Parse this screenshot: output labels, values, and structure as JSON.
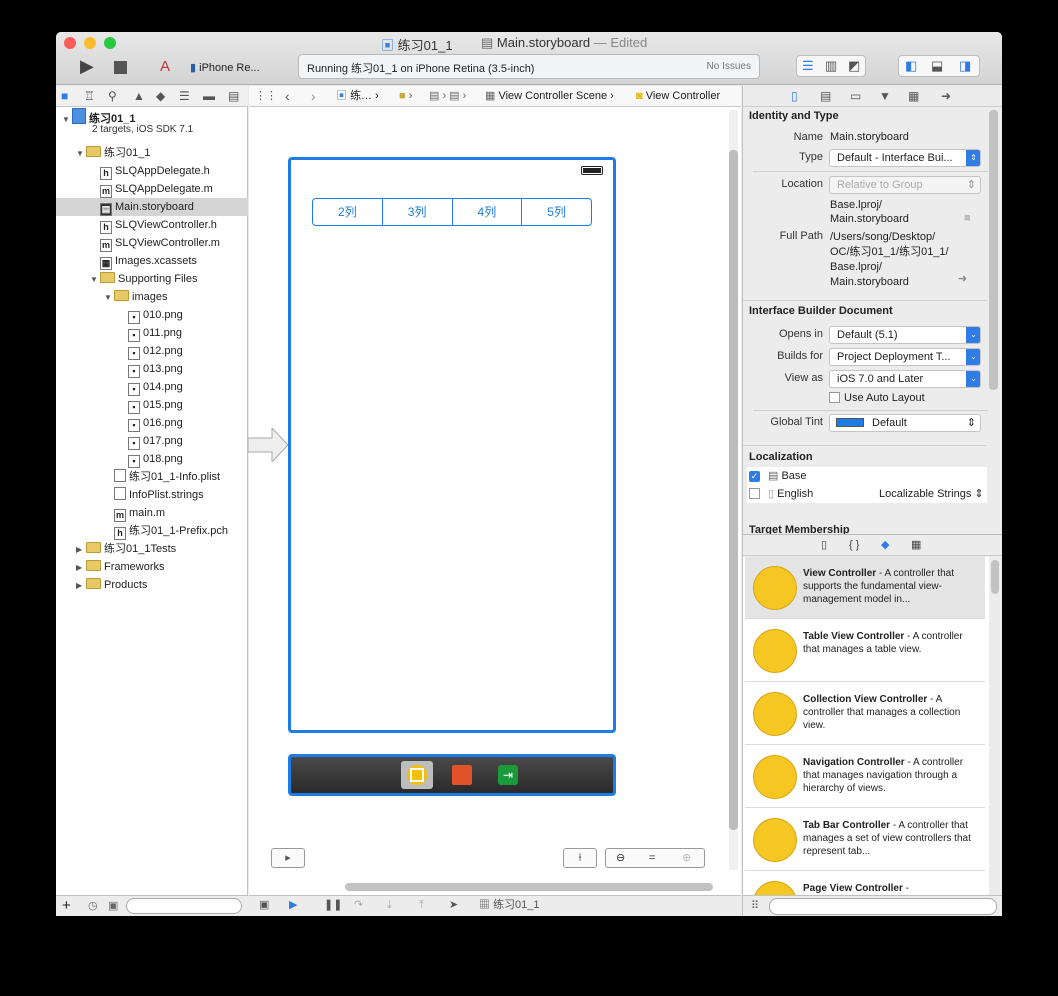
{
  "window": {
    "title_project": "练习01_1",
    "title_file": "Main.storyboard",
    "title_state": "— Edited"
  },
  "toolbar": {
    "scheme_target": "iPhone Re...",
    "status": "Running 练习01_1 on iPhone Retina (3.5-inch)",
    "issues": "No Issues"
  },
  "navigator": {
    "items": [
      {
        "label": "练习01_1",
        "sub": "2 targets, iOS SDK 7.1",
        "level": 0,
        "type": "project",
        "open": true
      },
      {
        "label": "练习01_1",
        "level": 1,
        "type": "folder",
        "open": true
      },
      {
        "label": "SLQAppDelegate.h",
        "level": 2,
        "type": "h"
      },
      {
        "label": "SLQAppDelegate.m",
        "level": 2,
        "type": "m"
      },
      {
        "label": "Main.storyboard",
        "level": 2,
        "type": "sb",
        "selected": true
      },
      {
        "label": "SLQViewController.h",
        "level": 2,
        "type": "h"
      },
      {
        "label": "SLQViewController.m",
        "level": 2,
        "type": "m"
      },
      {
        "label": "Images.xcassets",
        "level": 2,
        "type": "assets"
      },
      {
        "label": "Supporting Files",
        "level": 2,
        "type": "folder",
        "open": true
      },
      {
        "label": "images",
        "level": 3,
        "type": "folder",
        "open": true
      },
      {
        "label": "010.png",
        "level": 4,
        "type": "png"
      },
      {
        "label": "011.png",
        "level": 4,
        "type": "png"
      },
      {
        "label": "012.png",
        "level": 4,
        "type": "png"
      },
      {
        "label": "013.png",
        "level": 4,
        "type": "png"
      },
      {
        "label": "014.png",
        "level": 4,
        "type": "png"
      },
      {
        "label": "015.png",
        "level": 4,
        "type": "png"
      },
      {
        "label": "016.png",
        "level": 4,
        "type": "png"
      },
      {
        "label": "017.png",
        "level": 4,
        "type": "png"
      },
      {
        "label": "018.png",
        "level": 4,
        "type": "png"
      },
      {
        "label": "练习01_1-Info.plist",
        "level": 3,
        "type": "file"
      },
      {
        "label": "InfoPlist.strings",
        "level": 3,
        "type": "file"
      },
      {
        "label": "main.m",
        "level": 3,
        "type": "m"
      },
      {
        "label": "练习01_1-Prefix.pch",
        "level": 3,
        "type": "h"
      },
      {
        "label": "练习01_1Tests",
        "level": 1,
        "type": "folder",
        "open": false
      },
      {
        "label": "Frameworks",
        "level": 1,
        "type": "folder",
        "open": false
      },
      {
        "label": "Products",
        "level": 1,
        "type": "folder",
        "open": false
      }
    ]
  },
  "jumpbar": {
    "project": "练…",
    "scene": "View Controller Scene",
    "controller": "View Controller"
  },
  "canvas": {
    "segments": [
      "2列",
      "3列",
      "4列",
      "5列"
    ],
    "accent": "#1d7ce6"
  },
  "debugbar": {
    "target": "练习01_1"
  },
  "inspector": {
    "identity": {
      "title": "Identity and Type",
      "name_label": "Name",
      "name": "Main.storyboard",
      "type_label": "Type",
      "type": "Default - Interface Bui...",
      "location_label": "Location",
      "location": "Relative to Group",
      "rel_path1": "Base.lproj/",
      "rel_path2": "Main.storyboard",
      "fullpath_label": "Full Path",
      "fullpath": [
        "/Users/song/Desktop/",
        "OC/练习01_1/练习01_1/",
        "Base.lproj/",
        "Main.storyboard"
      ]
    },
    "ibdoc": {
      "title": "Interface Builder Document",
      "opens_label": "Opens in",
      "opens": "Default (5.1)",
      "builds_label": "Builds for",
      "builds": "Project Deployment T...",
      "viewas_label": "View as",
      "viewas": "iOS 7.0 and Later",
      "autolayout": "Use Auto Layout",
      "tint_label": "Global Tint",
      "tint": "Default"
    },
    "localization": {
      "title": "Localization",
      "base": "Base",
      "english": "English",
      "english_type": "Localizable Strings"
    },
    "membership": {
      "title": "Target Membership"
    }
  },
  "library": [
    {
      "name": "View Controller",
      "desc": " - A controller that supports the fundamental view-management model in..."
    },
    {
      "name": "Table View Controller",
      "desc": " - A controller that manages a table view."
    },
    {
      "name": "Collection View Controller",
      "desc": " - A controller that manages a collection view."
    },
    {
      "name": "Navigation Controller",
      "desc": " - A controller that manages navigation through a hierarchy of views."
    },
    {
      "name": "Tab Bar Controller",
      "desc": " - A controller that manages a set of view controllers that represent tab..."
    },
    {
      "name": "Page View Controller",
      "desc": " -"
    }
  ]
}
